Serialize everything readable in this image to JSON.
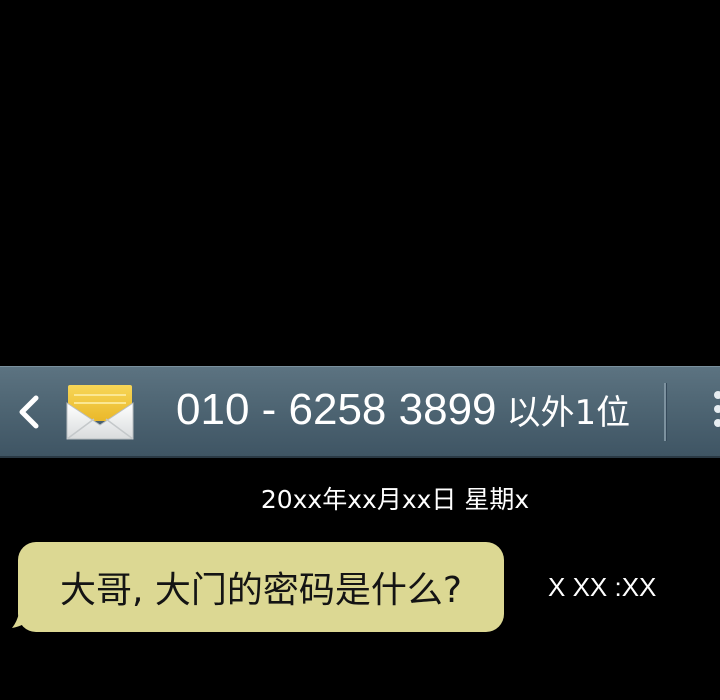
{
  "header": {
    "title_number": "010 - 6258 3899",
    "title_suffix": "以外1位",
    "back_icon": "chevron-left-icon",
    "message_icon": "envelope-icon",
    "menu_icon": "more-vertical-icon"
  },
  "conversation": {
    "date": "20xx年xx月xx日 星期x",
    "messages": [
      {
        "text": "大哥, 大门的密码是什么?",
        "time": "X XX :XX"
      }
    ]
  },
  "colors": {
    "background": "#000000",
    "header_bar": "#4e6573",
    "bubble": "#dcd893",
    "envelope_flap": "#f2c737"
  }
}
